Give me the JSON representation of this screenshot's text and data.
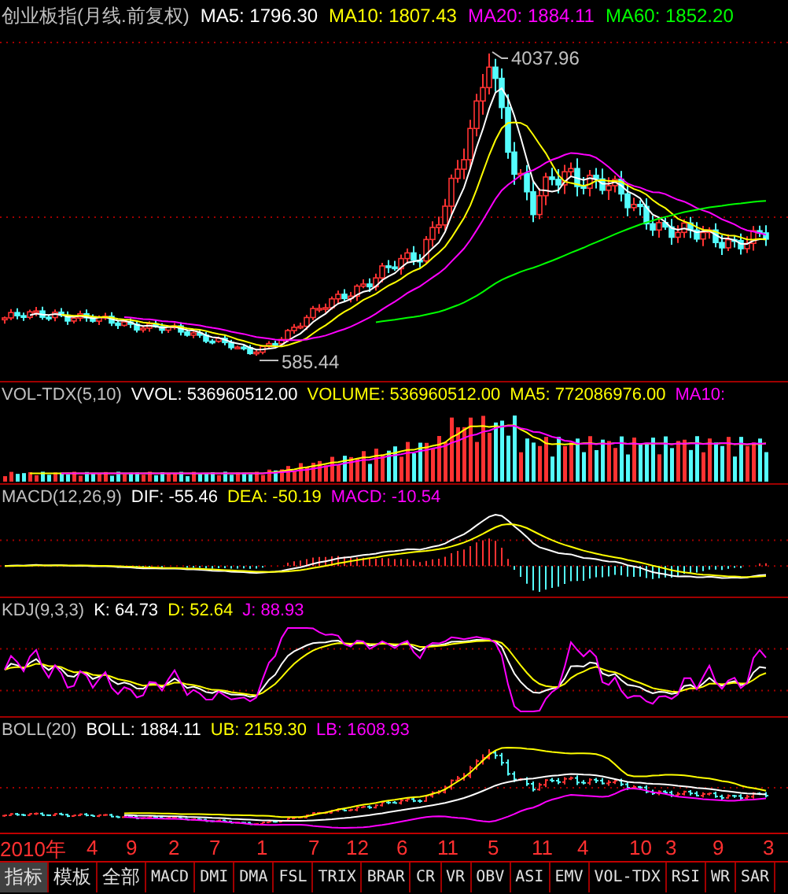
{
  "title": {
    "name": "创业板指(月线.前复权)",
    "indicators": [
      {
        "label": "MA5: 1796.30",
        "color": "#ffffff"
      },
      {
        "label": "MA10: 1807.43",
        "color": "#ffff00"
      },
      {
        "label": "MA20: 1884.11",
        "color": "#ff00ff"
      },
      {
        "label": "MA60: 1852.20",
        "color": "#00ff00"
      }
    ]
  },
  "main_chart": {
    "high_label": "4037.96",
    "low_label": "585.44"
  },
  "panels": [
    {
      "kind": "vol",
      "name": "VOL-TDX(5,10)",
      "indicators": [
        {
          "label": "VVOL: 536960512.00",
          "color": "#ffffff"
        },
        {
          "label": "VOLUME: 536960512.00",
          "color": "#ffff00"
        },
        {
          "label": "MA5: 772086976.00",
          "color": "#ffff00"
        },
        {
          "label": "MA10:",
          "color": "#ff00ff"
        }
      ]
    },
    {
      "kind": "macd",
      "name": "MACD(12,26,9)",
      "indicators": [
        {
          "label": "DIF: -55.46",
          "color": "#ffffff"
        },
        {
          "label": "DEA: -50.19",
          "color": "#ffff00"
        },
        {
          "label": "MACD: -10.54",
          "color": "#ff00ff"
        }
      ]
    },
    {
      "kind": "kdj",
      "name": "KDJ(9,3,3)",
      "indicators": [
        {
          "label": "K: 64.73",
          "color": "#ffffff"
        },
        {
          "label": "D: 52.64",
          "color": "#ffff00"
        },
        {
          "label": "J: 88.93",
          "color": "#ff00ff"
        }
      ]
    },
    {
      "kind": "boll",
      "name": "BOLL(20)",
      "indicators": [
        {
          "label": "BOLL: 1884.11",
          "color": "#ffffff"
        },
        {
          "label": "UB: 2159.30",
          "color": "#ffff00"
        },
        {
          "label": "LB: 1608.93",
          "color": "#ff00ff"
        }
      ]
    }
  ],
  "time_axis": [
    "2010年",
    "4",
    "9",
    "2",
    "7",
    "1",
    "7",
    "12",
    "6",
    "11",
    "5",
    "11",
    "4",
    "10",
    "3",
    "9",
    "3"
  ],
  "tabs": [
    {
      "label": "指标",
      "selected": true
    },
    {
      "label": "模板",
      "selected": false
    },
    {
      "label": "全部",
      "selected": false
    },
    {
      "label": "MACD",
      "selected": false
    },
    {
      "label": "DMI",
      "selected": false
    },
    {
      "label": "DMA",
      "selected": false
    },
    {
      "label": "FSL",
      "selected": false
    },
    {
      "label": "TRIX",
      "selected": false
    },
    {
      "label": "BRAR",
      "selected": false
    },
    {
      "label": "CR",
      "selected": false
    },
    {
      "label": "VR",
      "selected": false
    },
    {
      "label": "OBV",
      "selected": false
    },
    {
      "label": "ASI",
      "selected": false
    },
    {
      "label": "EMV",
      "selected": false
    },
    {
      "label": "VOL-TDX",
      "selected": false
    },
    {
      "label": "RSI",
      "selected": false
    },
    {
      "label": "WR",
      "selected": false
    },
    {
      "label": "SAR",
      "selected": false
    }
  ]
}
